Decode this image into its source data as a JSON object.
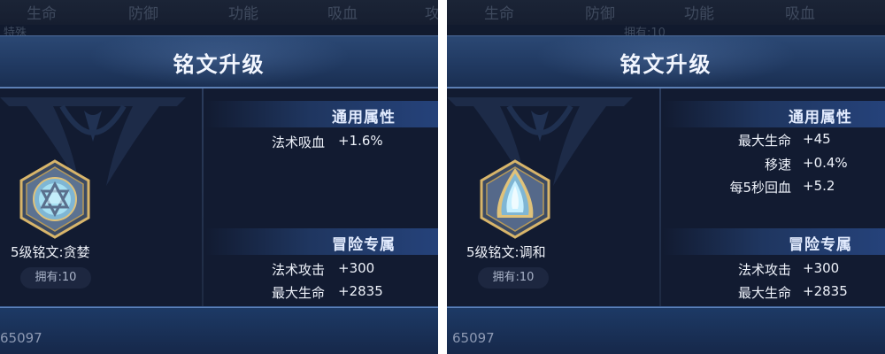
{
  "panels": [
    {
      "top_tabs": [
        "生命",
        "防御",
        "功能",
        "吸血",
        "攻"
      ],
      "top_sub": "特殊",
      "title": "铭文升级",
      "general_section": {
        "title": "通用属性",
        "stats": [
          {
            "label": "法术吸血",
            "value": "+1.6%"
          }
        ]
      },
      "adventure_section": {
        "title": "冒险专属",
        "stats": [
          {
            "label": "法术攻击",
            "value": "+300"
          },
          {
            "label": "最大生命",
            "value": "+2835"
          }
        ]
      },
      "rune_name": "5级铭文:贪婪",
      "owned": "拥有:10",
      "footer_number": "65097",
      "rune_icon": "hexagon-star-rune-icon"
    },
    {
      "top_tabs": [
        "生命",
        "防御",
        "功能",
        "吸血"
      ],
      "top_sub": "拥有:10",
      "title": "铭文升级",
      "general_section": {
        "title": "通用属性",
        "stats": [
          {
            "label": "最大生命",
            "value": "+45"
          },
          {
            "label": "移速",
            "value": "+0.4%"
          },
          {
            "label": "每5秒回血",
            "value": "+5.2"
          }
        ]
      },
      "adventure_section": {
        "title": "冒险专属",
        "stats": [
          {
            "label": "法术攻击",
            "value": "+300"
          },
          {
            "label": "最大生命",
            "value": "+2835"
          }
        ]
      },
      "rune_name": "5级铭文:调和",
      "owned": "拥有:10",
      "footer_number": "65097",
      "rune_icon": "hexagon-drop-rune-icon"
    }
  ],
  "colors": {
    "background": "#111a2e",
    "header": "#213a62",
    "accent_gold": "#d8b56a",
    "rune_blue": "#8fd6f0",
    "text": "#eef2fa"
  }
}
